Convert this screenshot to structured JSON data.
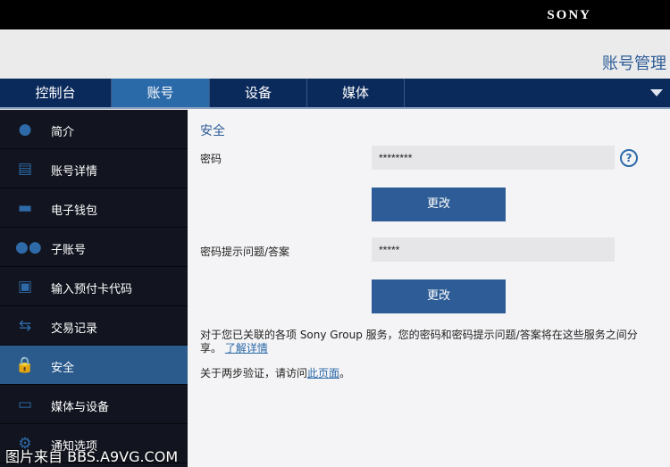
{
  "header": {
    "brand": "SONY",
    "page_title": "账号管理"
  },
  "tabs": [
    {
      "label": "控制台"
    },
    {
      "label": "账号",
      "active": true
    },
    {
      "label": "设备"
    },
    {
      "label": "媒体"
    }
  ],
  "sidebar": {
    "items": [
      {
        "label": "简介",
        "icon": "person-icon"
      },
      {
        "label": "账号详情",
        "icon": "document-icon"
      },
      {
        "label": "电子钱包",
        "icon": "wallet-icon"
      },
      {
        "label": "子账号",
        "icon": "users-icon"
      },
      {
        "label": "输入预付卡代码",
        "icon": "gift-icon"
      },
      {
        "label": "交易记录",
        "icon": "transfer-icon"
      },
      {
        "label": "安全",
        "icon": "lock-icon",
        "active": true
      },
      {
        "label": "媒体与设备",
        "icon": "media-icon"
      },
      {
        "label": "通知选项",
        "icon": "gear-icon"
      }
    ]
  },
  "main": {
    "heading": "安全",
    "password_label": "密码",
    "password_value": "********",
    "change_label": "更改",
    "hint_label": "密码提示问题/答案",
    "hint_value": "*****",
    "help": "?",
    "info_text": "对于您已关联的各项 Sony Group 服务，您的密码和密码提示问题/答案将在这些服务之间分享。",
    "learn_more": "了解详情",
    "two_step_text": "关于两步验证，请访问",
    "two_step_link": "此页面",
    "two_step_end": "。"
  },
  "watermark": "图片来自 BBS.A9VG.COM"
}
